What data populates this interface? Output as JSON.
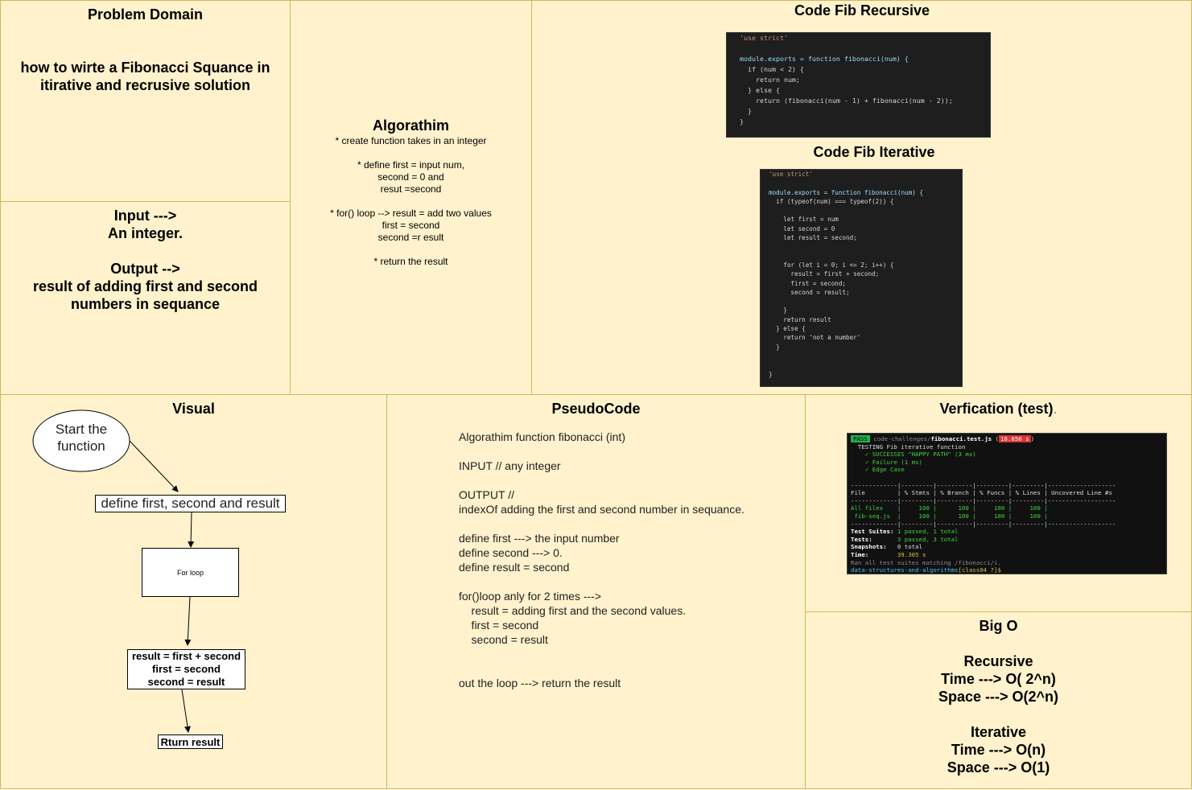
{
  "problem": {
    "title": "Problem Domain",
    "text": "how to wirte a Fibonacci Squance in\nitirative and recrusive solution"
  },
  "io": {
    "text": "Input --->\nAn integer.\n\nOutput -->\nresult of adding first and second\nnumbers in sequance"
  },
  "algorithm": {
    "title": "Algorathim",
    "text": "* create function takes in an integer\n\n*  define first = input num,\nsecond = 0 and\nresut =second\n\n* for() loop --> result = add two values\nfirst = second\nsecond =r esult\n\n*  return the result"
  },
  "code_recursive": {
    "title": "Code Fib Recursive",
    "lines": [
      "'use strict'",
      "",
      "module.exports = function fibonacci(num) {",
      "  if (num < 2) {",
      "    return num;",
      "  } else {",
      "    return (fibonacci(num - 1) + fibonacci(num - 2));",
      "  }",
      "}"
    ]
  },
  "code_iterative": {
    "title": "Code Fib Iterative",
    "lines": [
      "'use strict'",
      "",
      "module.exports = function fibonacci(num) {",
      "  if (typeof(num) === typeof(2)) {",
      "",
      "    let first = num",
      "    let second = 0",
      "    let result = second;",
      "",
      "",
      "    for (let i = 0; i <= 2; i++) {",
      "      result = first + second;",
      "      first = second;",
      "      second = result;",
      "",
      "    }",
      "    return result",
      "  } else {",
      "    return 'not a number'",
      "  }",
      "",
      "",
      "}"
    ]
  },
  "visual": {
    "title": "Visual",
    "start": "Start the\nfunction",
    "define": "define first, second and result",
    "loop": "For loop",
    "body": "result = first + second\nfirst = second\nsecond = result",
    "ret": "Rturn result"
  },
  "pseudo": {
    "title": "PseudoCode",
    "text": "Algorathim function fibonacci (int)\n\nINPUT // any integer\n\nOUTPUT //\nindexOf adding the first and second number in sequance.\n\ndefine first ---> the input number\ndefine second ---> 0.\ndefine result = second\n\nfor()loop anly for 2 times --->\n    result = adding first and the second values.\n    first = second\n    second = result\n\n\nout the loop ---> return the result"
  },
  "verification": {
    "title": "Verfication (test)",
    "title_suffix": ".",
    "terminal": {
      "pass_label": "PASS",
      "file_dim": "code-challenges/",
      "file_name": "fibonacci.test.js",
      "time_badge": "16.656 s",
      "describe": "TESTING Fib iterative function",
      "tests": [
        "✓ SUCCESSES \"HAPPY PATH\" (3 ms)",
        "✓ Failure (1 ms)",
        "✓ Edge Case"
      ],
      "sep": "-------------|---------|----------|---------|---------|-------------------",
      "header": "File         | % Stmts | % Branch | % Funcs | % Lines | Uncovered Line #s",
      "rows": [
        "All files    |     100 |      100 |     100 |     100 |",
        " fib-seq.js  |     100 |      100 |     100 |     100 |"
      ],
      "summary_labels": [
        "Test Suites:",
        "Tests:",
        "Snapshots:",
        "Time:"
      ],
      "summary_values": [
        "1 passed, 1 total",
        "3 passed, 3 total",
        "0 total",
        "39.305 s"
      ],
      "ran": "Ran all test suites matching /fibonacci/i.",
      "prompt_path": "data-structures-and-algorithms",
      "prompt_branch": "[class04 ?]$"
    }
  },
  "bigo": {
    "text": "Big O\n\nRecursive\nTime ---> O( 2^n)\nSpace ---> O(2^n)\n\nIterative\nTime ---> O(n)\nSpace ---> O(1)"
  }
}
